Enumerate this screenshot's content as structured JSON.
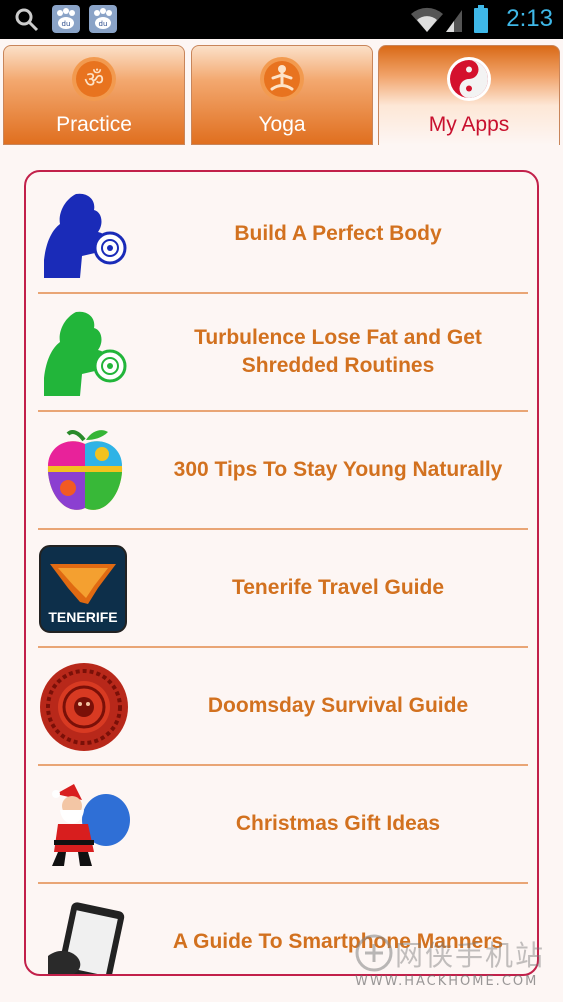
{
  "status_bar": {
    "time": "2:13",
    "icons": [
      "search-icon",
      "baidu-icon",
      "baidu-icon",
      "wifi-icon",
      "signal-icon",
      "battery-icon"
    ],
    "time_color": "#3fb8e8"
  },
  "tabs": [
    {
      "label": "Practice",
      "icon": "om-icon",
      "active": false
    },
    {
      "label": "Yoga",
      "icon": "meditation-icon",
      "active": false
    },
    {
      "label": "My Apps",
      "icon": "yin-yang-icon",
      "active": true
    }
  ],
  "apps": [
    {
      "title": "Build A Perfect Body",
      "icon": "blue-bodybuilder-icon"
    },
    {
      "title": "Turbulence Lose Fat and Get Shredded Routines",
      "icon": "green-bodybuilder-icon"
    },
    {
      "title": "300 Tips To Stay Young Naturally",
      "icon": "puzzle-apple-icon"
    },
    {
      "title": "Tenerife Travel Guide",
      "icon": "tenerife-icon",
      "icon_text": "TENERIFE"
    },
    {
      "title": "Doomsday Survival Guide",
      "icon": "aztec-calendar-icon"
    },
    {
      "title": "Christmas Gift Ideas",
      "icon": "santa-icon"
    },
    {
      "title": "A Guide To Smartphone Manners",
      "icon": "smartphone-icon"
    }
  ],
  "watermark": {
    "text_cn": "网侠手机站",
    "url": "WWW.HACKHOME.COM"
  },
  "colors": {
    "accent_orange": "#d2711f",
    "card_border": "#c2204a",
    "active_tab_text": "#c8102e"
  }
}
